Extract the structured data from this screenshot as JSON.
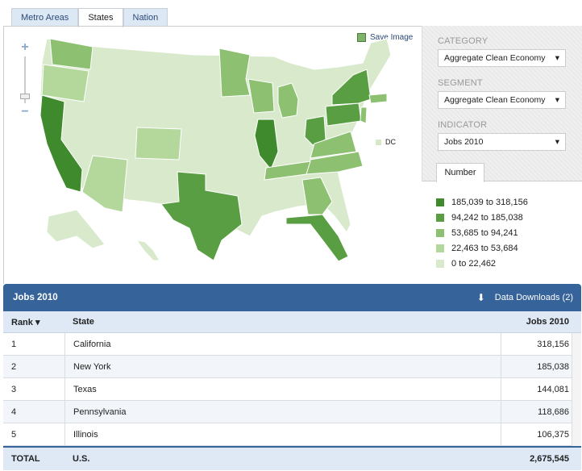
{
  "tabs": [
    "Metro Areas",
    "States",
    "Nation"
  ],
  "active_tab": "States",
  "map": {
    "save_label": "Save Image",
    "dc_label": "DC",
    "zoom_in": "+",
    "zoom_out": "−"
  },
  "filters": {
    "category": {
      "label": "CATEGORY",
      "value": "Aggregate Clean Economy"
    },
    "segment": {
      "label": "SEGMENT",
      "value": "Aggregate Clean Economy"
    },
    "indicator": {
      "label": "INDICATOR",
      "value": "Jobs 2010"
    }
  },
  "legend_tab": "Number",
  "legend": [
    {
      "label": "185,039 to 318,156",
      "color": "#3f8a2c"
    },
    {
      "label": "94,242 to 185,038",
      "color": "#5a9e44"
    },
    {
      "label": "53,685 to 94,241",
      "color": "#8dc071"
    },
    {
      "label": "22,463 to 53,684",
      "color": "#b4d89c"
    },
    {
      "label": "0 to 22,462",
      "color": "#d8eacb"
    }
  ],
  "table": {
    "title": "Jobs 2010",
    "downloads": "Data Downloads (2)",
    "columns": [
      "Rank ▾",
      "State",
      "Jobs 2010"
    ],
    "rows": [
      [
        "1",
        "California",
        "318,156"
      ],
      [
        "2",
        "New York",
        "185,038"
      ],
      [
        "3",
        "Texas",
        "144,081"
      ],
      [
        "4",
        "Pennsylvania",
        "118,686"
      ],
      [
        "5",
        "Illinois",
        "106,375"
      ]
    ],
    "total": [
      "TOTAL",
      "U.S.",
      "2,675,545"
    ]
  }
}
